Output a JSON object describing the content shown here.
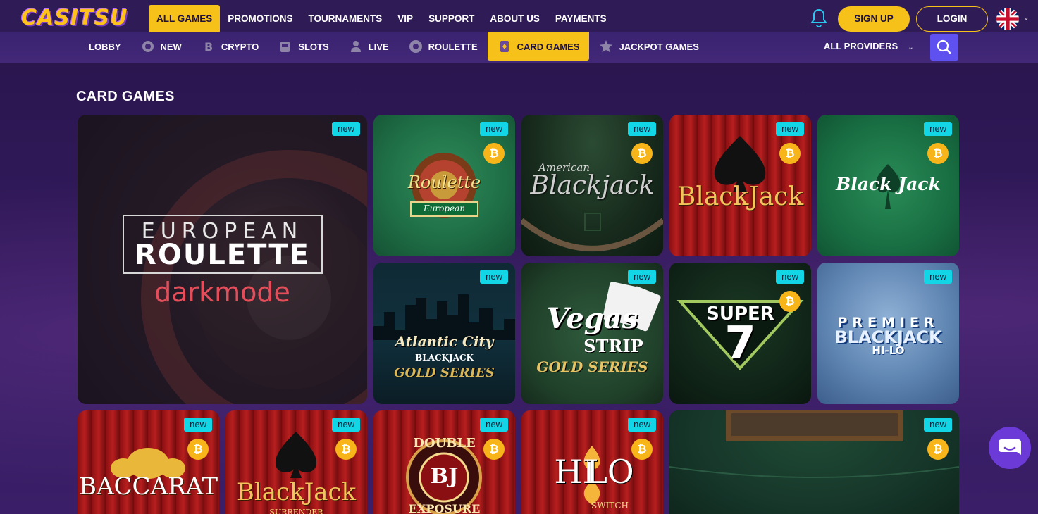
{
  "brand": {
    "logo_text": "CASITSU"
  },
  "main_nav": [
    {
      "label": "ALL GAMES",
      "active": true
    },
    {
      "label": "PROMOTIONS"
    },
    {
      "label": "TOURNAMENTS"
    },
    {
      "label": "VIP"
    },
    {
      "label": "SUPPORT"
    },
    {
      "label": "ABOUT US"
    },
    {
      "label": "PAYMENTS"
    }
  ],
  "header": {
    "signup_label": "SIGN UP",
    "login_label": "LOGIN",
    "language_icon": "uk-flag-icon"
  },
  "sub_nav": [
    {
      "label": "LOBBY",
      "icon": ""
    },
    {
      "label": "NEW",
      "icon": "new-gear-icon"
    },
    {
      "label": "CRYPTO",
      "icon": "bitcoin-icon"
    },
    {
      "label": "SLOTS",
      "icon": "slot-machine-icon"
    },
    {
      "label": "LIVE",
      "icon": "dealer-icon"
    },
    {
      "label": "ROULETTE",
      "icon": "roulette-icon"
    },
    {
      "label": "CARD GAMES",
      "icon": "card-icon",
      "active": true
    },
    {
      "label": "JACKPOT GAMES",
      "icon": "star-icon"
    }
  ],
  "providers": {
    "label": "ALL PROVIDERS"
  },
  "section": {
    "title": "CARD GAMES"
  },
  "badges": {
    "new": "new",
    "btc": "₿"
  },
  "games": [
    {
      "title_line1": "EUROPEAN",
      "title_line2": "ROULETTE",
      "title_line3": "darkmode"
    },
    {
      "title_line1": "Roulette",
      "title_line2": "European"
    },
    {
      "title_line1": "American",
      "title_line2": "Blackjack"
    },
    {
      "title_line1": "BlackJack"
    },
    {
      "title_line1": "Black Jack"
    },
    {
      "title_line1": "Atlantic City",
      "title_line2": "BLACKJACK",
      "title_line3": "GOLD SERIES"
    },
    {
      "title_line1": "Vegas",
      "title_line2": "STRIP",
      "title_line3": "GOLD SERIES"
    },
    {
      "title_line1": "SUPER",
      "title_line2": "7"
    },
    {
      "title_line1": "PREMIER",
      "title_line2": "BLACKJACK",
      "title_line3": "HI-LO"
    },
    {
      "title_line1": "BACCARAT"
    },
    {
      "title_line1": "BlackJack",
      "title_line2": "SURRENDER"
    },
    {
      "title_line1": "DOUBLE",
      "title_line2": "BJ",
      "title_line3": "EXPOSURE"
    },
    {
      "title_line1": "HI",
      "title_line2": "LO",
      "title_line3": "SWITCH"
    },
    {
      "title_line1": ""
    }
  ]
}
